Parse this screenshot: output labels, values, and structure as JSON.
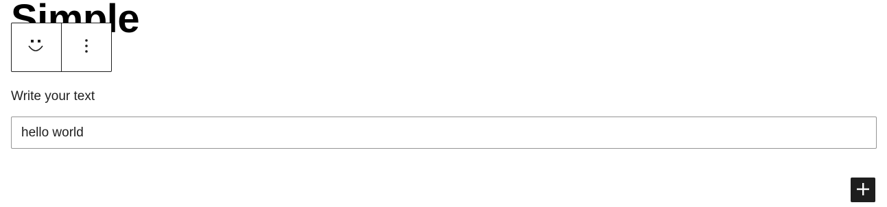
{
  "block": {
    "heading": "Simple",
    "toolbar": {
      "block_icon": "smiley-icon",
      "options_icon": "more-vertical-icon"
    },
    "field": {
      "label": "Write your text",
      "value": "hello world"
    }
  },
  "inserter": {
    "icon": "plus-icon"
  },
  "colors": {
    "text": "#1e1e1e",
    "input_border": "#949494",
    "inserter_bg": "#1e1e1e"
  }
}
